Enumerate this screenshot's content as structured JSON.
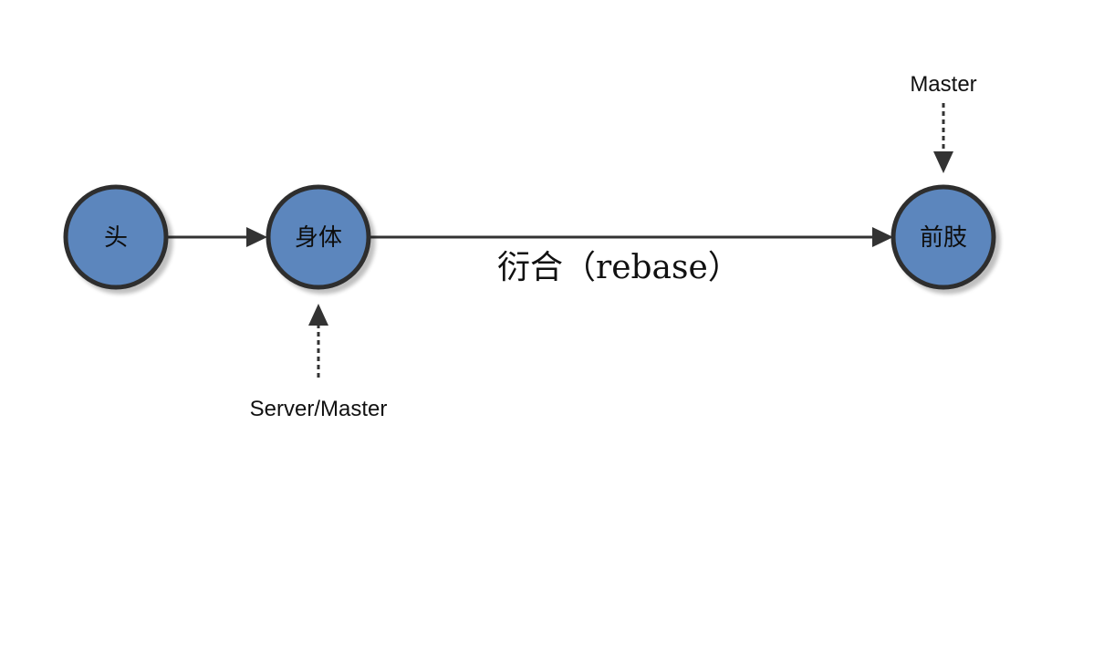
{
  "colors": {
    "node_fill": "#5b86bd",
    "node_stroke": "#2e2e2e",
    "arrow": "#333333"
  },
  "nodes": [
    {
      "id": "head",
      "label": "头"
    },
    {
      "id": "body",
      "label": "身体"
    },
    {
      "id": "limbs",
      "label": "前肢"
    }
  ],
  "edges": [
    {
      "from": "head",
      "to": "body",
      "label": ""
    },
    {
      "from": "body",
      "to": "limbs",
      "label": "衍合（rebase）"
    }
  ],
  "pointers": [
    {
      "target": "body",
      "label": "Server/Master",
      "style": "dashed"
    },
    {
      "target": "limbs",
      "label": "Master",
      "style": "dashed"
    }
  ]
}
